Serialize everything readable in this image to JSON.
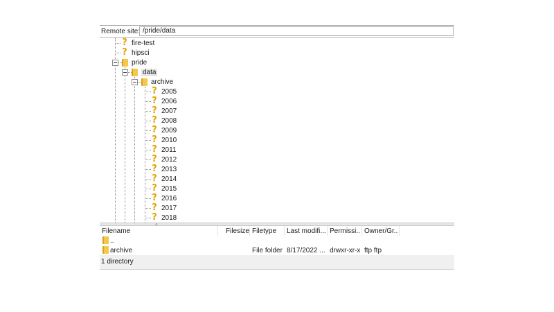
{
  "remote": {
    "label": "Remote site:",
    "path": "/pride/data"
  },
  "tree": {
    "nodes": [
      {
        "label": "fire-test",
        "type": "unknown"
      },
      {
        "label": "hipsci",
        "type": "unknown"
      },
      {
        "label": "pride",
        "type": "folder",
        "expanded": true
      },
      {
        "label": "data",
        "type": "folder",
        "expanded": true,
        "selected": true
      },
      {
        "label": "archive",
        "type": "folder",
        "expanded": true
      },
      {
        "label": "2005",
        "type": "unknown"
      },
      {
        "label": "2006",
        "type": "unknown"
      },
      {
        "label": "2007",
        "type": "unknown"
      },
      {
        "label": "2008",
        "type": "unknown"
      },
      {
        "label": "2009",
        "type": "unknown"
      },
      {
        "label": "2010",
        "type": "unknown"
      },
      {
        "label": "2011",
        "type": "unknown"
      },
      {
        "label": "2012",
        "type": "unknown"
      },
      {
        "label": "2013",
        "type": "unknown"
      },
      {
        "label": "2014",
        "type": "unknown"
      },
      {
        "label": "2015",
        "type": "unknown"
      },
      {
        "label": "2016",
        "type": "unknown"
      },
      {
        "label": "2017",
        "type": "unknown"
      },
      {
        "label": "2018",
        "type": "unknown"
      }
    ]
  },
  "list": {
    "columns": [
      "Filename",
      "Filesize",
      "Filetype",
      "Last modifi...",
      "Permissi...",
      "Owner/Gr..."
    ],
    "rows": [
      {
        "name": "..",
        "size": "",
        "type": "",
        "modified": "",
        "perms": "",
        "owner": ""
      },
      {
        "name": "archive",
        "size": "",
        "type": "File folder",
        "modified": "8/17/2022 ...",
        "perms": "drwxr-xr-x",
        "owner": "ftp ftp"
      }
    ]
  },
  "status": {
    "text": "1 directory"
  },
  "icons": {
    "unknown": "question-mark-icon",
    "folder": "folder-icon",
    "expander": "collapse-icon"
  },
  "colors": {
    "folder": "#f3c94b",
    "question": "#e1a500",
    "selected": "#e6e6e6"
  }
}
